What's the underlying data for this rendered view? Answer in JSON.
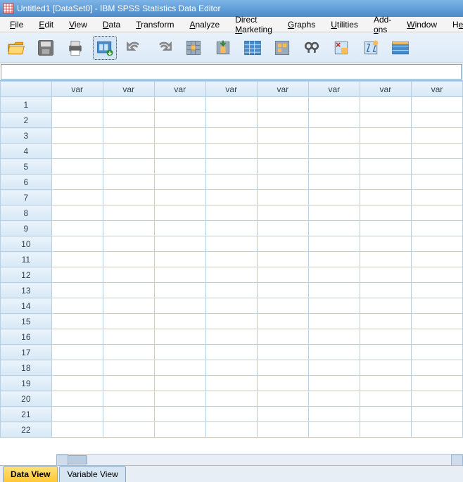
{
  "title": "Untitled1 [DataSet0] - IBM SPSS Statistics Data Editor",
  "menus": [
    "File",
    "Edit",
    "View",
    "Data",
    "Transform",
    "Analyze",
    "Direct Marketing",
    "Graphs",
    "Utilities",
    "Add-ons",
    "Window",
    "Help"
  ],
  "menu_mnemonic_index": [
    0,
    0,
    0,
    0,
    0,
    0,
    7,
    0,
    0,
    4,
    0,
    1
  ],
  "toolbar": {
    "open": "Open",
    "save": "Save",
    "print": "Print",
    "recall": "Recall Dialog",
    "undo": "Undo",
    "redo": "Redo",
    "goto_case": "Go To Case",
    "goto_var": "Go To Variable",
    "variables": "Variables",
    "run_descriptives": "Run Descriptives",
    "find": "Find",
    "insert_cases": "Insert Cases",
    "insert_var": "Insert Variable",
    "split": "Split File"
  },
  "formula": "",
  "columns": [
    "var",
    "var",
    "var",
    "var",
    "var",
    "var",
    "var",
    "var"
  ],
  "row_count": 22,
  "tabs": {
    "data_view": "Data View",
    "variable_view": "Variable View",
    "active": "data_view"
  },
  "icons": {
    "app": "spss-grid"
  }
}
